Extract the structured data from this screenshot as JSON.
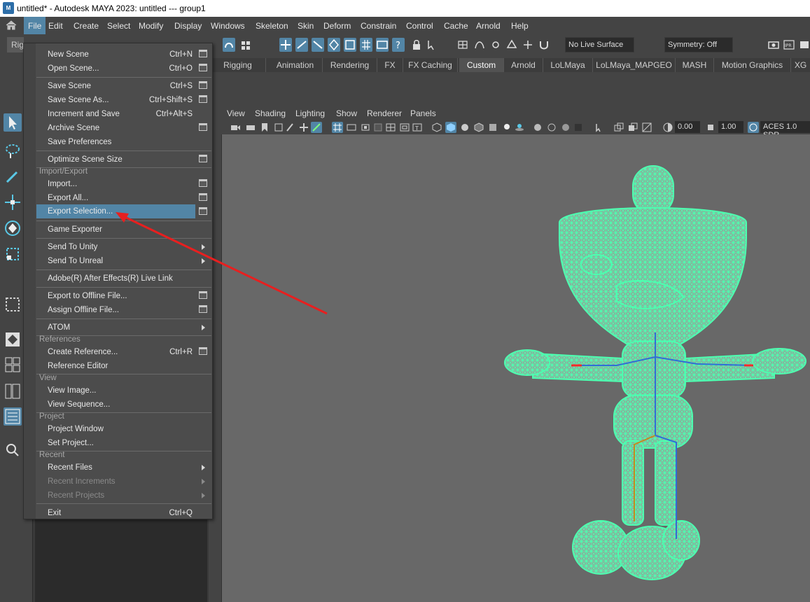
{
  "window": {
    "title": "untitled* - Autodesk MAYA 2023: untitled   ---   group1",
    "app_icon_text": "M"
  },
  "menubar": {
    "items": [
      "File",
      "Edit",
      "Create",
      "Select",
      "Modify",
      "Display",
      "Windows",
      "Skeleton",
      "Skin",
      "Deform",
      "Constrain",
      "Control",
      "Cache",
      "Arnold",
      "Help"
    ],
    "active": "File"
  },
  "toolbar": {
    "menuset": "Rig",
    "live_surface": "No Live Surface",
    "symmetry": "Symmetry: Off",
    "ipr_label": "IPR"
  },
  "shelf": {
    "tabs": [
      "Rigging",
      "Animation",
      "Rendering",
      "FX",
      "FX Caching",
      "Custom",
      "Arnold",
      "LoLMaya",
      "LoLMaya_MAPGEO",
      "MASH",
      "Motion Graphics",
      "XG"
    ],
    "active_tab": "Custom"
  },
  "viewport": {
    "menu": [
      "View",
      "Shading",
      "Lighting",
      "Show",
      "Renderer",
      "Panels"
    ],
    "near_value": "0.00",
    "far_value": "1.00",
    "color_space": "ACES 1.0 SDR",
    "mesh_color": "#4dffb0",
    "background_color": "#686868"
  },
  "file_menu": {
    "highlight_color": "#5285a6",
    "items": [
      {
        "label": "New Scene",
        "shortcut": "Ctrl+N",
        "option": true
      },
      {
        "label": "Open Scene...",
        "shortcut": "Ctrl+O",
        "option": true
      },
      {
        "label": "Save Scene",
        "shortcut": "Ctrl+S",
        "option": true
      },
      {
        "label": "Save Scene As...",
        "shortcut": "Ctrl+Shift+S",
        "option": true
      },
      {
        "label": "Increment and Save",
        "shortcut": "Ctrl+Alt+S",
        "option": false
      },
      {
        "label": "Archive Scene",
        "shortcut": "",
        "option": true
      },
      {
        "label": "Save Preferences",
        "shortcut": "",
        "option": false
      },
      {
        "label": "Optimize Scene Size",
        "shortcut": "",
        "option": true
      },
      {
        "label": "Import...",
        "shortcut": "",
        "option": true
      },
      {
        "label": "Export All...",
        "shortcut": "",
        "option": true
      },
      {
        "label": "Export Selection...",
        "shortcut": "",
        "option": true,
        "highlighted": true
      },
      {
        "label": "Game Exporter",
        "shortcut": "",
        "option": false
      },
      {
        "label": "Send To Unity",
        "shortcut": "",
        "submenu": true
      },
      {
        "label": "Send To Unreal",
        "shortcut": "",
        "submenu": true
      },
      {
        "label": "Adobe(R) After Effects(R) Live Link",
        "shortcut": ""
      },
      {
        "label": "Export to Offline File...",
        "shortcut": "",
        "option": true
      },
      {
        "label": "Assign Offline File...",
        "shortcut": "",
        "option": true
      },
      {
        "label": "ATOM",
        "shortcut": "",
        "submenu": true
      },
      {
        "label": "Create Reference...",
        "shortcut": "Ctrl+R",
        "option": true
      },
      {
        "label": "Reference Editor",
        "shortcut": ""
      },
      {
        "label": "View Image...",
        "shortcut": ""
      },
      {
        "label": "View Sequence...",
        "shortcut": ""
      },
      {
        "label": "Project Window",
        "shortcut": ""
      },
      {
        "label": "Set Project...",
        "shortcut": ""
      },
      {
        "label": "Recent Files",
        "shortcut": "",
        "submenu": true
      },
      {
        "label": "Recent Increments",
        "shortcut": "",
        "submenu": true,
        "disabled": true
      },
      {
        "label": "Recent Projects",
        "shortcut": "",
        "submenu": true,
        "disabled": true
      },
      {
        "label": "Exit",
        "shortcut": "Ctrl+Q"
      }
    ],
    "sections": [
      "Import/Export",
      "References",
      "View",
      "Project",
      "Recent"
    ]
  },
  "annotation": {
    "arrow_color": "#e81f1f"
  }
}
